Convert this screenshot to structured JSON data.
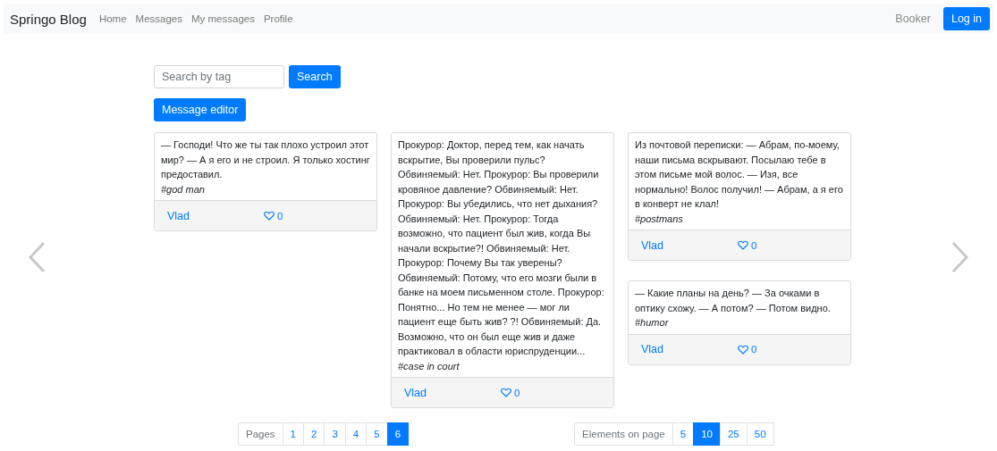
{
  "navbar": {
    "brand": "Springo Blog",
    "links": [
      {
        "label": "Home"
      },
      {
        "label": "Messages"
      },
      {
        "label": "My messages"
      },
      {
        "label": "Profile"
      }
    ],
    "user": "Booker",
    "login_button": "Log in"
  },
  "search": {
    "placeholder": "Search by tag",
    "button": "Search"
  },
  "editor_button": "Message editor",
  "columns": [
    {
      "cards": [
        {
          "text": "— Господи! Что же ты так плохо устроил этот мир? — А я его и не строил. Я только хостинг предоставил.",
          "tag": "#god man",
          "author": "Vlad",
          "likes": "0"
        }
      ]
    },
    {
      "cards": [
        {
          "text": "Прокурор: Доктор, перед тем, как начать вскрытие, Вы проверили пульс? Обвиняемый: Нет. Прокурор: Вы проверили кровяное давление? Обвиняемый: Нет. Прокурор: Вы убедились, что нет дыхания? Обвиняемый: Нет. Прокурор: Тогда возможно, что пациент был жив, когда Вы начали вскрытие?! Обвиняемый: Нет. Прокурор: Почему Вы так уверены? Обвиняемый: Потому, что его мозги были в банке на моем письменном столе. Прокурор: Понятно... Но тем не менее — мог ли пациент еще быть жив? ?! Обвиняемый: Да. Возможно, что он был еще жив и даже практиковал в области юриспруденции...",
          "tag": "#case in court",
          "author": "Vlad",
          "likes": "0"
        }
      ]
    },
    {
      "cards": [
        {
          "text": "Из почтовой переписки: — Абрам, по-моему, наши письма вскрывают. Посылаю тебе в этом письме мой волос. — Изя, все нормально! Волос получил! — Абрам, а я его в конверт не клал!",
          "tag": "#postmans",
          "author": "Vlad",
          "likes": "0"
        },
        {
          "text": "— Какие планы на день? — За очками в оптику схожу. — А потом? — Потом видно.",
          "tag": "#humor",
          "author": "Vlad",
          "likes": "0"
        }
      ]
    }
  ],
  "pagination": {
    "label": "Pages",
    "pages": [
      {
        "label": "1",
        "selected": false
      },
      {
        "label": "2",
        "selected": false
      },
      {
        "label": "3",
        "selected": false
      },
      {
        "label": "4",
        "selected": false
      },
      {
        "label": "5",
        "selected": false
      },
      {
        "label": "6",
        "selected": true
      }
    ]
  },
  "page_size": {
    "label": "Elements on page",
    "options": [
      {
        "label": "5",
        "selected": false
      },
      {
        "label": "10",
        "selected": true
      },
      {
        "label": "25",
        "selected": false
      },
      {
        "label": "50",
        "selected": false
      }
    ]
  }
}
